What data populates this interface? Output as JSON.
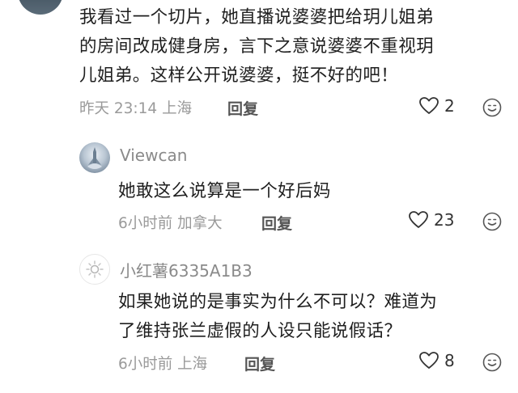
{
  "top_comment": {
    "lines": [
      "我看过一个切片，她直播说婆婆把给玥儿姐弟",
      "的房间改成健身房，言下之意说婆婆不重视玥",
      "儿姐弟。这样公开说婆婆，挺不好的吧！"
    ],
    "meta": "昨天 23:14 上海",
    "reply_label": "回复",
    "likes": "2"
  },
  "replies": [
    {
      "username": "Viewcan",
      "lines": [
        "她敢这么说算是一个好后妈"
      ],
      "meta": "6小时前 加拿大",
      "reply_label": "回复",
      "likes": "23"
    },
    {
      "username": "小红薯6335A1B3",
      "lines": [
        "如果她说的是事实为什么不可以？难道为",
        "了维持张兰虚假的人设只能说假话？"
      ],
      "meta": "6小时前 上海",
      "reply_label": "回复",
      "likes": "8"
    }
  ],
  "icons": {
    "like": "heart-outline-icon",
    "emoji": "emoji-face-icon"
  },
  "colors": {
    "text": "#1f1f1f",
    "meta": "#9a9a9a",
    "reply": "#555555"
  }
}
